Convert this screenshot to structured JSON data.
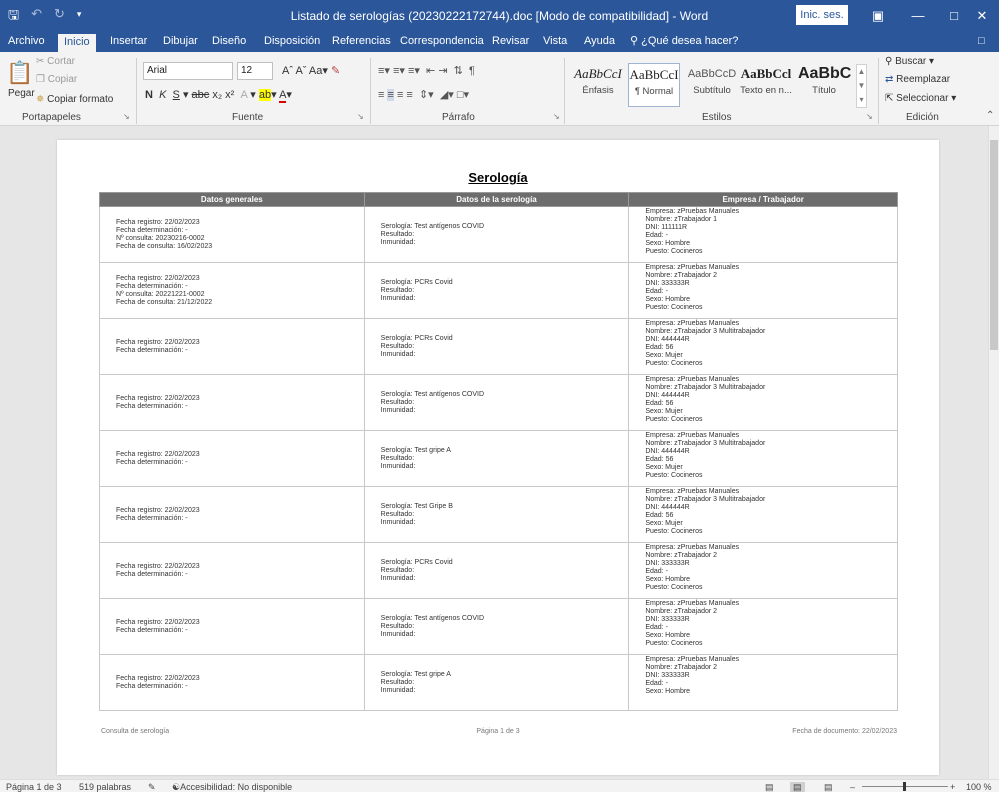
{
  "titlebar": {
    "title": "Listado de serologías (20230222172744).doc [Modo de compatibilidad] - Word",
    "sign_in": "Inic. ses."
  },
  "tabs": [
    "Archivo",
    "Inicio",
    "Insertar",
    "Dibujar",
    "Diseño",
    "Disposición",
    "Referencias",
    "Correspondencia",
    "Revisar",
    "Vista",
    "Ayuda"
  ],
  "tell_me": "¿Qué desea hacer?",
  "ribbon": {
    "clipboard": {
      "paste": "Pegar",
      "cut": "Cortar",
      "copy": "Copiar",
      "format_painter": "Copiar formato",
      "label": "Portapapeles"
    },
    "font": {
      "name": "Arial",
      "size": "12",
      "label": "Fuente"
    },
    "paragraph": {
      "label": "Párrafo"
    },
    "styles": {
      "label": "Estilos",
      "items": [
        {
          "sample": "AaBbCcI",
          "name": "Énfasis"
        },
        {
          "sample": "AaBbCcI",
          "name": "¶ Normal"
        },
        {
          "sample": "AaBbCcD",
          "name": "Subtítulo"
        },
        {
          "sample": "AaBbCcl",
          "name": "Texto en n..."
        },
        {
          "sample": "AaBbC",
          "name": "Título"
        }
      ]
    },
    "editing": {
      "find": "Buscar",
      "replace": "Reemplazar",
      "select": "Seleccionar",
      "label": "Edición"
    }
  },
  "document": {
    "title": "Serología",
    "headers": [
      "Datos generales",
      "Datos de la serología",
      "Empresa / Trabajador"
    ],
    "rows": [
      {
        "general": [
          "Fecha registro: 22/02/2023",
          "Fecha determinación: -",
          "Nº consulta: 20230216-0002",
          "Fecha de consulta: 16/02/2023"
        ],
        "serology": [
          "Serología: Test antígenos COVID",
          "Resultado:",
          "Inmunidad:"
        ],
        "company": [
          "Empresa: zPruebas Manuales",
          "Nombre: zTrabajador 1",
          "DNI: 111111R",
          "Edad: -",
          "Sexo: Hombre",
          "Puesto: Cocineros"
        ]
      },
      {
        "general": [
          "Fecha registro: 22/02/2023",
          "Fecha determinación: -",
          "Nº consulta: 20221221-0002",
          "Fecha de consulta: 21/12/2022"
        ],
        "serology": [
          "Serología: PCRs Covid",
          "Resultado:",
          "Inmunidad:"
        ],
        "company": [
          "Empresa: zPruebas Manuales",
          "Nombre: zTrabajador 2",
          "DNI: 333333R",
          "Edad: -",
          "Sexo: Hombre",
          "Puesto: Cocineros"
        ]
      },
      {
        "general": [
          "Fecha registro: 22/02/2023",
          "Fecha determinación: -"
        ],
        "serology": [
          "Serología: PCRs Covid",
          "Resultado:",
          "Inmunidad:"
        ],
        "company": [
          "Empresa: zPruebas Manuales",
          "Nombre: zTrabajador 3 Multitrabajador",
          "DNI: 444444R",
          "Edad: 56",
          "Sexo: Mujer",
          "Puesto: Cocineros"
        ]
      },
      {
        "general": [
          "Fecha registro: 22/02/2023",
          "Fecha determinación: -"
        ],
        "serology": [
          "Serología: Test antígenos COVID",
          "Resultado:",
          "Inmunidad:"
        ],
        "company": [
          "Empresa: zPruebas Manuales",
          "Nombre: zTrabajador 3 Multitrabajador",
          "DNI: 444444R",
          "Edad: 56",
          "Sexo: Mujer",
          "Puesto: Cocineros"
        ]
      },
      {
        "general": [
          "Fecha registro: 22/02/2023",
          "Fecha determinación: -"
        ],
        "serology": [
          "Serología: Test gripe A",
          "Resultado:",
          "Inmunidad:"
        ],
        "company": [
          "Empresa: zPruebas Manuales",
          "Nombre: zTrabajador 3 Multitrabajador",
          "DNI: 444444R",
          "Edad: 56",
          "Sexo: Mujer",
          "Puesto: Cocineros"
        ]
      },
      {
        "general": [
          "Fecha registro: 22/02/2023",
          "Fecha determinación: -"
        ],
        "serology": [
          "Serología: Test Gripe B",
          "Resultado:",
          "Inmunidad:"
        ],
        "company": [
          "Empresa: zPruebas Manuales",
          "Nombre: zTrabajador 3 Multitrabajador",
          "DNI: 444444R",
          "Edad: 56",
          "Sexo: Mujer",
          "Puesto: Cocineros"
        ]
      },
      {
        "general": [
          "Fecha registro: 22/02/2023",
          "Fecha determinación: -"
        ],
        "serology": [
          "Serología: PCRs Covid",
          "Resultado:",
          "Inmunidad:"
        ],
        "company": [
          "Empresa: zPruebas Manuales",
          "Nombre: zTrabajador 2",
          "DNI: 333333R",
          "Edad: -",
          "Sexo: Hombre",
          "Puesto: Cocineros"
        ]
      },
      {
        "general": [
          "Fecha registro: 22/02/2023",
          "Fecha determinación: -"
        ],
        "serology": [
          "Serología: Test antígenos COVID",
          "Resultado:",
          "Inmunidad:"
        ],
        "company": [
          "Empresa: zPruebas Manuales",
          "Nombre: zTrabajador 2",
          "DNI: 333333R",
          "Edad: -",
          "Sexo: Hombre",
          "Puesto: Cocineros"
        ]
      },
      {
        "general": [
          "Fecha registro: 22/02/2023",
          "Fecha determinación: -"
        ],
        "serology": [
          "Serología: Test gripe A",
          "Resultado:",
          "Inmunidad:"
        ],
        "company": [
          "Empresa: zPruebas Manuales",
          "Nombre: zTrabajador 2",
          "DNI: 333333R",
          "Edad: -",
          "Sexo: Hombre"
        ]
      }
    ],
    "footer": {
      "left": "Consulta de serología",
      "center": "Página 1 de 3",
      "right": "Fecha de documento: 22/02/2023"
    }
  },
  "status": {
    "page": "Página 1 de 3",
    "words": "519 palabras",
    "accessibility": "Accesibilidad: No disponible",
    "zoom": "100 %"
  }
}
